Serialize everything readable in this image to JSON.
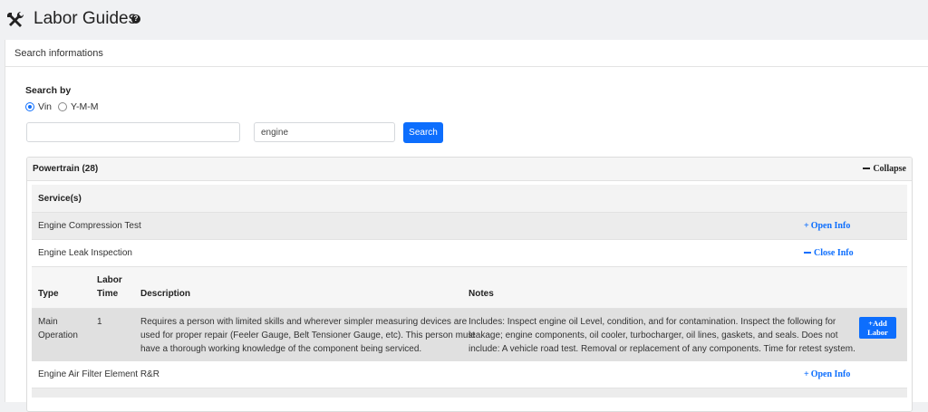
{
  "header": {
    "title": "Labor Guides",
    "help": "?"
  },
  "panel": {
    "heading": "Search informations"
  },
  "search": {
    "search_by_label": "Search by",
    "radio_vin": "Vin",
    "radio_ymm": "Y-M-M",
    "selected": "Vin",
    "vin_value": "",
    "keyword_value": "engine",
    "button": "Search"
  },
  "group": {
    "title": "Powertrain (28)",
    "collapse_label": "Collapse",
    "services_heading": "Service(s)",
    "items": [
      {
        "label": "Engine Compression Test",
        "action": "Open Info"
      },
      {
        "label": "Engine Leak Inspection",
        "action": "Close Info"
      },
      {
        "label": "Engine Air Filter Element R&R",
        "action": "Open Info"
      }
    ],
    "detail": {
      "columns": {
        "type": "Type",
        "labor_time_1": "Labor",
        "labor_time_2": "Time",
        "description": "Description",
        "notes": "Notes"
      },
      "row": {
        "type_1": "Main",
        "type_2": "Operation",
        "labor_time": "1",
        "description_1": "Requires a person with limited skills and wherever simpler measuring devices are",
        "description_2": "used for proper repair (Feeler Gauge, Belt Tensioner Gauge, etc). This person must",
        "description_3": "have a thorough working knowledge of the component being serviced.",
        "notes_1": "Includes: Inspect engine oil Level, condition, and for contamination. Inspect the following for",
        "notes_2": "leakage; engine components, oil cooler, turbocharger, oil lines, gaskets, and seals. Does not",
        "notes_3": "include: A vehicle road test. Removal or replacement of any components. Time for retest system.",
        "add_btn_1": "+Add",
        "add_btn_2": "Labor"
      }
    }
  }
}
